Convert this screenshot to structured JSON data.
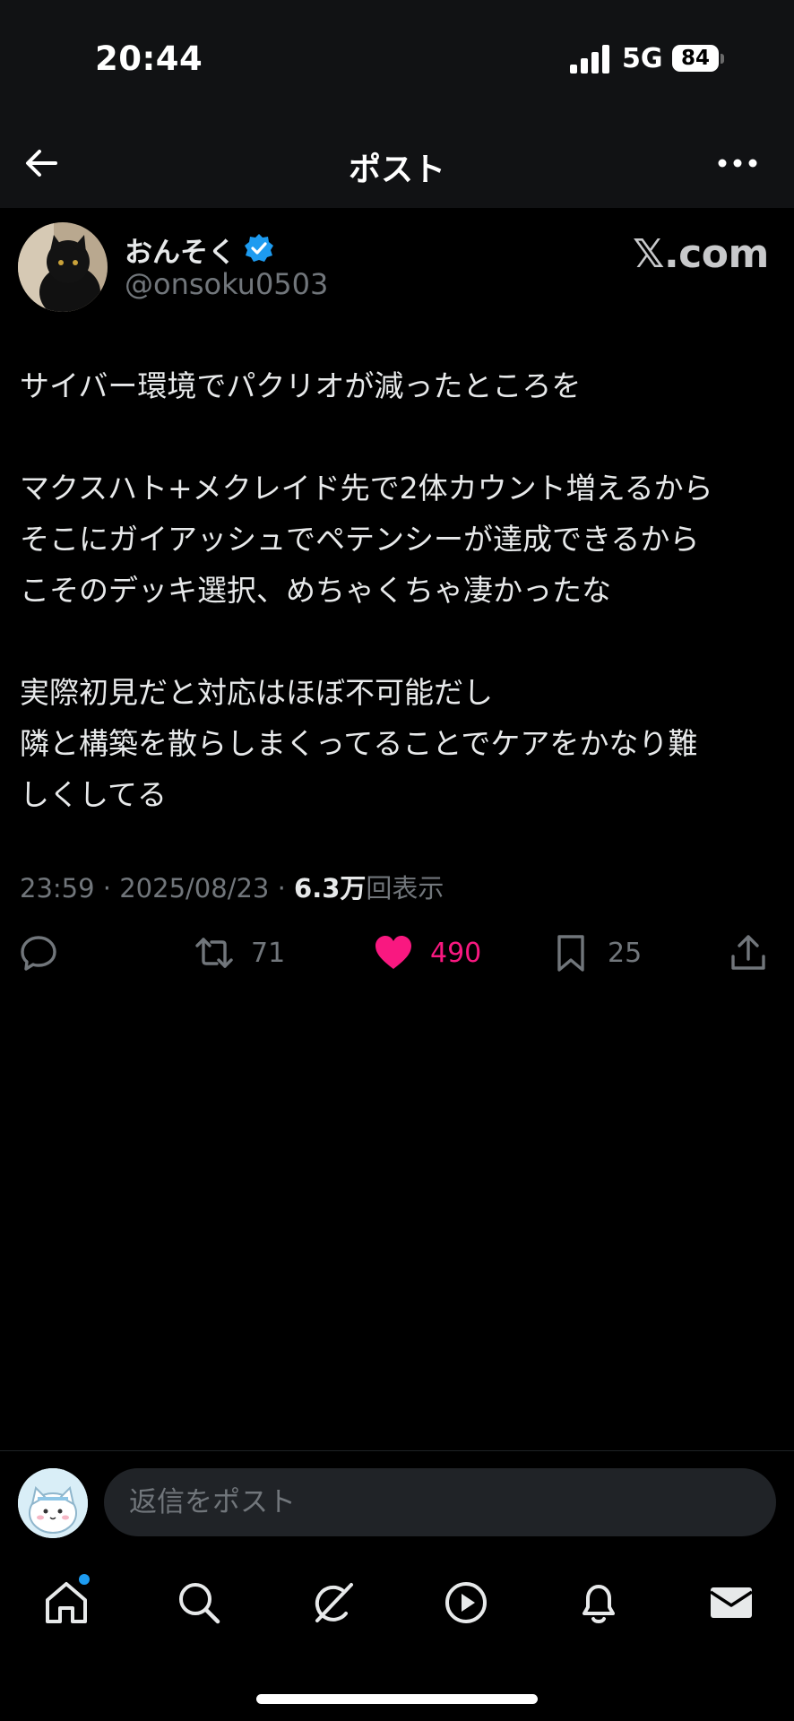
{
  "status_bar": {
    "time": "20:44",
    "network": "5G",
    "battery": "84"
  },
  "nav": {
    "title": "ポスト"
  },
  "author": {
    "display_name": "おんそく",
    "handle": "@onsoku0503",
    "source_badge": "𝕏.com"
  },
  "post": {
    "lines": [
      "サイバー環境でパクリオが減ったところを",
      "",
      "マクスハト+メクレイド先で2体カウント増えるから",
      "そこにガイアッシュでペテンシーが達成できるから",
      "こそのデッキ選択、めちゃくちゃ凄かったな",
      "",
      "実際初見だと対応はほぼ不可能だし",
      "隣と構築を散らしまくってることでケアをかなり難",
      "しくしてる"
    ],
    "time": "23:59",
    "date": "2025/08/23",
    "sep": "·",
    "views_count": "6.3万",
    "views_label": "回表示"
  },
  "actions": {
    "retweets": "71",
    "likes": "490",
    "bookmarks": "25"
  },
  "reply": {
    "placeholder": "返信をポスト"
  },
  "colors": {
    "accent": "#1d9bf0",
    "like": "#f91880",
    "muted": "#71767b",
    "background": "#000000"
  },
  "icons": [
    "back-arrow-icon",
    "more-icon",
    "verified-icon",
    "reply-icon",
    "retweet-icon",
    "heart-icon",
    "bookmark-icon",
    "share-icon",
    "home-icon",
    "search-icon",
    "grok-icon",
    "video-icon",
    "bell-icon",
    "mail-icon"
  ]
}
